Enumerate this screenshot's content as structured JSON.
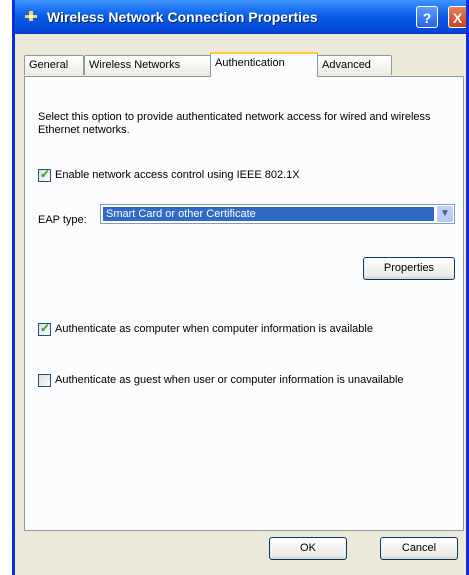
{
  "window": {
    "title": "Wireless Network Connection Properties",
    "help_label": "?",
    "close_label": "X"
  },
  "tabs": [
    {
      "label": "General",
      "active": false
    },
    {
      "label": "Wireless Networks",
      "active": false
    },
    {
      "label": "Authentication",
      "active": true
    },
    {
      "label": "Advanced",
      "active": false
    }
  ],
  "authentication": {
    "description": "Select this option to provide authenticated network access for wired and wireless Ethernet networks.",
    "enable_8021x": {
      "label": "Enable network access control using IEEE 802.1X",
      "checked": true
    },
    "eap_type_label": "EAP type:",
    "eap_type_value": "Smart Card or other Certificate",
    "properties_button": "Properties",
    "auth_as_computer": {
      "label": "Authenticate as computer when computer information is available",
      "checked": true
    },
    "auth_as_guest": {
      "label": "Authenticate as guest when user or computer information is unavailable",
      "checked": false
    }
  },
  "buttons": {
    "ok": "OK",
    "cancel": "Cancel"
  },
  "icons": {
    "title_icon": "network-connection-icon",
    "dropdown": "chevron-down-icon"
  },
  "colors": {
    "titlebar": "#0a5fe8",
    "selection": "#316ac5",
    "active_tab_accent": "#ffc83c",
    "check": "#21a121"
  }
}
